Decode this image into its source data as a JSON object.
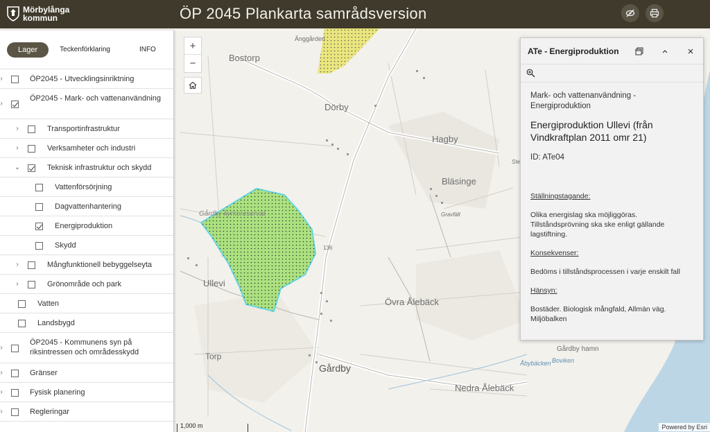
{
  "header": {
    "logo_text": "Mörbylånga\nkommun",
    "title": "ÖP 2045  Plankarta samrådsversion",
    "buttons": [
      {
        "name": "toggle-view-button",
        "icon": "eye-slash-icon"
      },
      {
        "name": "print-button",
        "icon": "printer-icon"
      }
    ]
  },
  "left_panel": {
    "tabs": {
      "layers": "Lager",
      "legend": "Teckenförklaring",
      "info": "INFO"
    },
    "layers": [
      {
        "label": "ÖP2045 - Utvecklingsinriktning",
        "level": 0,
        "checked": false,
        "expander": "none"
      },
      {
        "label": "ÖP2045 - Mark- och vattenanvändning",
        "level": 0,
        "checked": true,
        "expander": "none"
      },
      {
        "label": "Transportinfrastruktur",
        "level": 1,
        "checked": false,
        "expander": "right"
      },
      {
        "label": "Verksamheter och industri",
        "level": 1,
        "checked": false,
        "expander": "right"
      },
      {
        "label": "Teknisk infrastruktur och skydd",
        "level": 1,
        "checked": true,
        "expander": "down"
      },
      {
        "label": "Vattenförsörjning",
        "level": 2,
        "checked": false,
        "expander": "none"
      },
      {
        "label": "Dagvattenhantering",
        "level": 2,
        "checked": false,
        "expander": "none"
      },
      {
        "label": "Energiproduktion",
        "level": 2,
        "checked": true,
        "expander": "none"
      },
      {
        "label": "Skydd",
        "level": 2,
        "checked": false,
        "expander": "none"
      },
      {
        "label": "Mångfunktionell bebyggelseyta",
        "level": 1,
        "checked": false,
        "expander": "right"
      },
      {
        "label": "Grönområde och park",
        "level": 1,
        "checked": false,
        "expander": "right"
      },
      {
        "label": "Vatten",
        "level": 3,
        "checked": false,
        "expander": "none"
      },
      {
        "label": "Landsbygd",
        "level": 3,
        "checked": false,
        "expander": "none"
      },
      {
        "label": "ÖP2045 - Kommunens syn på riksintressen och områdesskydd",
        "level": 0,
        "checked": false,
        "expander": "none"
      },
      {
        "label": "Gränser",
        "level": 0,
        "checked": false,
        "expander": "none"
      },
      {
        "label": "Fysisk planering",
        "level": 0,
        "checked": false,
        "expander": "none"
      },
      {
        "label": "Regleringar",
        "level": 0,
        "checked": false,
        "expander": "none"
      }
    ]
  },
  "map": {
    "zoom_in": "+",
    "zoom_out": "−",
    "home_icon": "home-icon",
    "place_labels": [
      {
        "text": "Änggården",
        "size": 9
      },
      {
        "text": "Bostorp",
        "size": 13
      },
      {
        "text": "Dörby",
        "size": 13
      },
      {
        "text": "Hagby",
        "size": 13
      },
      {
        "text": "Bläsinge",
        "size": 13
      },
      {
        "text": "Gravfält",
        "size": 8
      },
      {
        "text": "Gårdby kyrkoreservat",
        "size": 10
      },
      {
        "text": "Ullevi",
        "size": 13
      },
      {
        "text": "Övra Ålebäck",
        "size": 13
      },
      {
        "text": "Torp",
        "size": 12
      },
      {
        "text": "Gårdby",
        "size": 14
      },
      {
        "text": "Gårdby hamn",
        "size": 10
      },
      {
        "text": "Åbybäcken",
        "size": 9
      },
      {
        "text": "Boviken",
        "size": 9
      },
      {
        "text": "Nedra Ålebäck",
        "size": 13
      },
      {
        "text": "136",
        "size": 8
      },
      {
        "text": "Ste",
        "size": 8
      }
    ],
    "scale_label": "1,000 m",
    "attribution": "Powered by Esri",
    "colors": {
      "energy_area_fill": "#a8e27a",
      "energy_area_stroke": "#5fd6e0",
      "yellow_area_fill": "#e8e46a",
      "water": "#bcd6e6"
    }
  },
  "popup": {
    "title": "ATe - Energiproduktion",
    "category": "Mark- och vattenanvändning - Energiproduktion",
    "name": "Energiproduktion Ullevi (från Vindkraftplan 2011 omr 21)",
    "id_line": "ID: ATe04",
    "heading_1": "Ställningstagande:",
    "text_1": "Olika energislag ska möjliggöras. Tillståndsprövning ska ske enligt gällande lagstiftning.",
    "heading_2": "Konsekvenser:",
    "text_2": "Bedöms i tillståndsprocessen i varje enskilt fall",
    "heading_3": "Hänsyn:",
    "text_3": "Bostäder. Biologisk mångfald, Allmän väg. Miljöbalken"
  }
}
